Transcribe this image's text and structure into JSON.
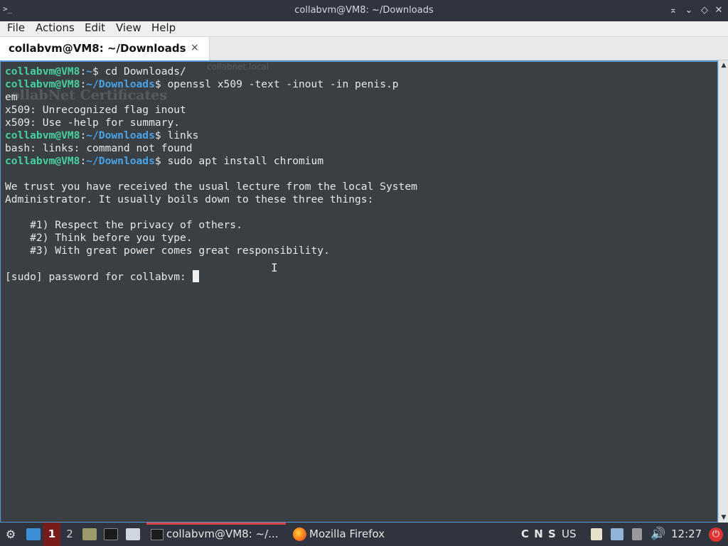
{
  "window": {
    "title": "collabvm@VM8: ~/Downloads",
    "icon": "terminal-icon",
    "controls": [
      "keep-above-icon",
      "minimize-icon",
      "maximize-icon",
      "close-icon"
    ]
  },
  "menu": {
    "items": [
      "File",
      "Actions",
      "Edit",
      "View",
      "Help"
    ]
  },
  "tab": {
    "label": "collabvm@VM8: ~/Downloads",
    "close": "×"
  },
  "terminal": {
    "lines": [
      {
        "user": "collabvm@VM8",
        "path": "~",
        "cmd": " cd Downloads/"
      },
      {
        "user": "collabvm@VM8",
        "path": "~/Downloads",
        "cmd": " openssl x509 -text -inout -in penis.p"
      },
      {
        "text": "em"
      },
      {
        "text": "x509: Unrecognized flag inout"
      },
      {
        "text": "x509: Use -help for summary."
      },
      {
        "user": "collabvm@VM8",
        "path": "~/Downloads",
        "cmd": " links"
      },
      {
        "text": "bash: links: command not found"
      },
      {
        "user": "collabvm@VM8",
        "path": "~/Downloads",
        "cmd": " sudo apt install chromium"
      },
      {
        "text": ""
      },
      {
        "text": "We trust you have received the usual lecture from the local System"
      },
      {
        "text": "Administrator. It usually boils down to these three things:"
      },
      {
        "text": ""
      },
      {
        "text": "    #1) Respect the privacy of others."
      },
      {
        "text": "    #2) Think before you type."
      },
      {
        "text": "    #3) With great power comes great responsibility."
      },
      {
        "text": ""
      },
      {
        "text": "[sudo] password for collabvm: ",
        "cursor": true
      }
    ],
    "ghost_title": "ollabNet Certificates",
    "ghost_url": "collabnet.local"
  },
  "taskbar": {
    "workspaces": [
      "1",
      "2"
    ],
    "tasks": [
      {
        "label": "collabvm@VM8: ~/...",
        "icon": "terminal-icon",
        "active": true
      },
      {
        "label": "Mozilla Firefox",
        "icon": "firefox-icon",
        "active": false
      }
    ],
    "keyboard_indicators": "C N S",
    "layout": "US",
    "clock": "12:27"
  },
  "colors": {
    "terminal_bg": "#3a3f44",
    "prompt_user": "#46d0a0",
    "prompt_path": "#4aa3e6",
    "titlebar_bg": "#2f343f",
    "workspace_active": "#7a1b1b"
  }
}
